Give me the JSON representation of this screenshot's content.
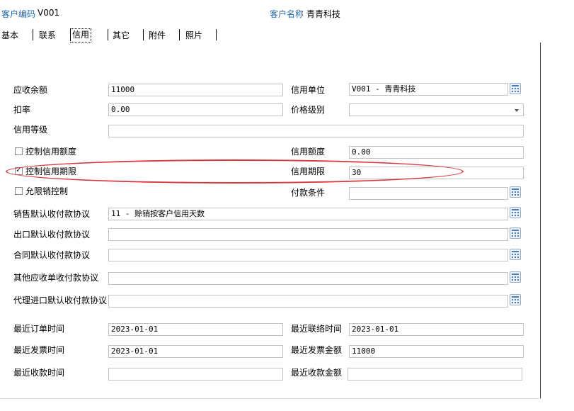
{
  "header": {
    "customer_code_label": "客户编码",
    "customer_code_value": "V001",
    "customer_name_label": "客户名称",
    "customer_name_value": "青青科技"
  },
  "tabs": [
    {
      "label": "基本"
    },
    {
      "label": "联系"
    },
    {
      "label": "信用",
      "active": true
    },
    {
      "label": "其它"
    },
    {
      "label": "附件"
    },
    {
      "label": "照片"
    }
  ],
  "form": {
    "receivable_balance": {
      "label": "应收余额",
      "value": "11000"
    },
    "credit_unit": {
      "label": "信用单位",
      "value": "V001 - 青青科技"
    },
    "discount_rate": {
      "label": "扣率",
      "value": "0.00"
    },
    "price_level": {
      "label": "价格级别",
      "value": ""
    },
    "credit_grade": {
      "label": "信用等级",
      "value": ""
    },
    "control_credit_amount": {
      "label": "控制信用额度",
      "checked": false
    },
    "credit_amount": {
      "label": "信用额度",
      "value": "0.00"
    },
    "control_credit_period": {
      "label": "控制信用期限",
      "checked": true
    },
    "credit_period": {
      "label": "信用期限",
      "value": "30"
    },
    "consignment_control": {
      "label": "允限销控制",
      "checked": false
    },
    "payment_terms": {
      "label": "付款条件",
      "value": ""
    },
    "sales_default_payment": {
      "label": "销售默认收付款协议",
      "value": "11 - 赊销按客户信用天数"
    },
    "export_default_payment": {
      "label": "出口默认收付款协议",
      "value": ""
    },
    "contract_default_payment": {
      "label": "合同默认收付款协议",
      "value": ""
    },
    "other_receivable_payment": {
      "label": "其他应收单收付款协议",
      "value": ""
    },
    "agency_import_payment": {
      "label": "代理进口默认收付款协议",
      "value": ""
    },
    "last_order_time": {
      "label": "最近订单时间",
      "value": "2023-01-01"
    },
    "last_contact_time": {
      "label": "最近联络时间",
      "value": "2023-01-01"
    },
    "last_invoice_time": {
      "label": "最近发票时间",
      "value": "2023-01-01"
    },
    "last_invoice_amount": {
      "label": "最近发票金额",
      "value": "11000"
    },
    "last_receipt_time": {
      "label": "最近收款时间",
      "value": ""
    },
    "last_receipt_amount": {
      "label": "最近收款金额",
      "value": ""
    }
  },
  "colors": {
    "header_label": "#1c68b4",
    "annotation_ellipse": "#d9383c",
    "lookup_icon": "#4a7ab8"
  }
}
